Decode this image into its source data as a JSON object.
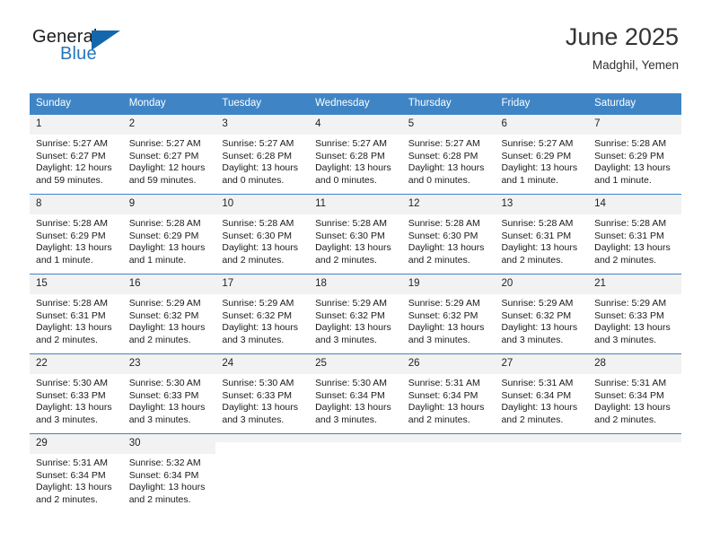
{
  "brand": {
    "name_part1": "General",
    "name_part2": "Blue",
    "triangle_color": "#1567ad",
    "blue_text_color": "#2476bd"
  },
  "header": {
    "title": "June 2025",
    "subtitle": "Madghil, Yemen",
    "header_bg": "#3f85c6",
    "daynum_bg": "#f2f2f2"
  },
  "weekdays": [
    "Sunday",
    "Monday",
    "Tuesday",
    "Wednesday",
    "Thursday",
    "Friday",
    "Saturday"
  ],
  "weeks": [
    [
      {
        "day": "1",
        "sunrise": "Sunrise: 5:27 AM",
        "sunset": "Sunset: 6:27 PM",
        "daylight_line1": "Daylight: 12 hours",
        "daylight_line2": "and 59 minutes."
      },
      {
        "day": "2",
        "sunrise": "Sunrise: 5:27 AM",
        "sunset": "Sunset: 6:27 PM",
        "daylight_line1": "Daylight: 12 hours",
        "daylight_line2": "and 59 minutes."
      },
      {
        "day": "3",
        "sunrise": "Sunrise: 5:27 AM",
        "sunset": "Sunset: 6:28 PM",
        "daylight_line1": "Daylight: 13 hours",
        "daylight_line2": "and 0 minutes."
      },
      {
        "day": "4",
        "sunrise": "Sunrise: 5:27 AM",
        "sunset": "Sunset: 6:28 PM",
        "daylight_line1": "Daylight: 13 hours",
        "daylight_line2": "and 0 minutes."
      },
      {
        "day": "5",
        "sunrise": "Sunrise: 5:27 AM",
        "sunset": "Sunset: 6:28 PM",
        "daylight_line1": "Daylight: 13 hours",
        "daylight_line2": "and 0 minutes."
      },
      {
        "day": "6",
        "sunrise": "Sunrise: 5:27 AM",
        "sunset": "Sunset: 6:29 PM",
        "daylight_line1": "Daylight: 13 hours",
        "daylight_line2": "and 1 minute."
      },
      {
        "day": "7",
        "sunrise": "Sunrise: 5:28 AM",
        "sunset": "Sunset: 6:29 PM",
        "daylight_line1": "Daylight: 13 hours",
        "daylight_line2": "and 1 minute."
      }
    ],
    [
      {
        "day": "8",
        "sunrise": "Sunrise: 5:28 AM",
        "sunset": "Sunset: 6:29 PM",
        "daylight_line1": "Daylight: 13 hours",
        "daylight_line2": "and 1 minute."
      },
      {
        "day": "9",
        "sunrise": "Sunrise: 5:28 AM",
        "sunset": "Sunset: 6:29 PM",
        "daylight_line1": "Daylight: 13 hours",
        "daylight_line2": "and 1 minute."
      },
      {
        "day": "10",
        "sunrise": "Sunrise: 5:28 AM",
        "sunset": "Sunset: 6:30 PM",
        "daylight_line1": "Daylight: 13 hours",
        "daylight_line2": "and 2 minutes."
      },
      {
        "day": "11",
        "sunrise": "Sunrise: 5:28 AM",
        "sunset": "Sunset: 6:30 PM",
        "daylight_line1": "Daylight: 13 hours",
        "daylight_line2": "and 2 minutes."
      },
      {
        "day": "12",
        "sunrise": "Sunrise: 5:28 AM",
        "sunset": "Sunset: 6:30 PM",
        "daylight_line1": "Daylight: 13 hours",
        "daylight_line2": "and 2 minutes."
      },
      {
        "day": "13",
        "sunrise": "Sunrise: 5:28 AM",
        "sunset": "Sunset: 6:31 PM",
        "daylight_line1": "Daylight: 13 hours",
        "daylight_line2": "and 2 minutes."
      },
      {
        "day": "14",
        "sunrise": "Sunrise: 5:28 AM",
        "sunset": "Sunset: 6:31 PM",
        "daylight_line1": "Daylight: 13 hours",
        "daylight_line2": "and 2 minutes."
      }
    ],
    [
      {
        "day": "15",
        "sunrise": "Sunrise: 5:28 AM",
        "sunset": "Sunset: 6:31 PM",
        "daylight_line1": "Daylight: 13 hours",
        "daylight_line2": "and 2 minutes."
      },
      {
        "day": "16",
        "sunrise": "Sunrise: 5:29 AM",
        "sunset": "Sunset: 6:32 PM",
        "daylight_line1": "Daylight: 13 hours",
        "daylight_line2": "and 2 minutes."
      },
      {
        "day": "17",
        "sunrise": "Sunrise: 5:29 AM",
        "sunset": "Sunset: 6:32 PM",
        "daylight_line1": "Daylight: 13 hours",
        "daylight_line2": "and 3 minutes."
      },
      {
        "day": "18",
        "sunrise": "Sunrise: 5:29 AM",
        "sunset": "Sunset: 6:32 PM",
        "daylight_line1": "Daylight: 13 hours",
        "daylight_line2": "and 3 minutes."
      },
      {
        "day": "19",
        "sunrise": "Sunrise: 5:29 AM",
        "sunset": "Sunset: 6:32 PM",
        "daylight_line1": "Daylight: 13 hours",
        "daylight_line2": "and 3 minutes."
      },
      {
        "day": "20",
        "sunrise": "Sunrise: 5:29 AM",
        "sunset": "Sunset: 6:32 PM",
        "daylight_line1": "Daylight: 13 hours",
        "daylight_line2": "and 3 minutes."
      },
      {
        "day": "21",
        "sunrise": "Sunrise: 5:29 AM",
        "sunset": "Sunset: 6:33 PM",
        "daylight_line1": "Daylight: 13 hours",
        "daylight_line2": "and 3 minutes."
      }
    ],
    [
      {
        "day": "22",
        "sunrise": "Sunrise: 5:30 AM",
        "sunset": "Sunset: 6:33 PM",
        "daylight_line1": "Daylight: 13 hours",
        "daylight_line2": "and 3 minutes."
      },
      {
        "day": "23",
        "sunrise": "Sunrise: 5:30 AM",
        "sunset": "Sunset: 6:33 PM",
        "daylight_line1": "Daylight: 13 hours",
        "daylight_line2": "and 3 minutes."
      },
      {
        "day": "24",
        "sunrise": "Sunrise: 5:30 AM",
        "sunset": "Sunset: 6:33 PM",
        "daylight_line1": "Daylight: 13 hours",
        "daylight_line2": "and 3 minutes."
      },
      {
        "day": "25",
        "sunrise": "Sunrise: 5:30 AM",
        "sunset": "Sunset: 6:34 PM",
        "daylight_line1": "Daylight: 13 hours",
        "daylight_line2": "and 3 minutes."
      },
      {
        "day": "26",
        "sunrise": "Sunrise: 5:31 AM",
        "sunset": "Sunset: 6:34 PM",
        "daylight_line1": "Daylight: 13 hours",
        "daylight_line2": "and 2 minutes."
      },
      {
        "day": "27",
        "sunrise": "Sunrise: 5:31 AM",
        "sunset": "Sunset: 6:34 PM",
        "daylight_line1": "Daylight: 13 hours",
        "daylight_line2": "and 2 minutes."
      },
      {
        "day": "28",
        "sunrise": "Sunrise: 5:31 AM",
        "sunset": "Sunset: 6:34 PM",
        "daylight_line1": "Daylight: 13 hours",
        "daylight_line2": "and 2 minutes."
      }
    ],
    [
      {
        "day": "29",
        "sunrise": "Sunrise: 5:31 AM",
        "sunset": "Sunset: 6:34 PM",
        "daylight_line1": "Daylight: 13 hours",
        "daylight_line2": "and 2 minutes."
      },
      {
        "day": "30",
        "sunrise": "Sunrise: 5:32 AM",
        "sunset": "Sunset: 6:34 PM",
        "daylight_line1": "Daylight: 13 hours",
        "daylight_line2": "and 2 minutes."
      },
      {
        "day": "",
        "sunrise": "",
        "sunset": "",
        "daylight_line1": "",
        "daylight_line2": ""
      },
      {
        "day": "",
        "sunrise": "",
        "sunset": "",
        "daylight_line1": "",
        "daylight_line2": ""
      },
      {
        "day": "",
        "sunrise": "",
        "sunset": "",
        "daylight_line1": "",
        "daylight_line2": ""
      },
      {
        "day": "",
        "sunrise": "",
        "sunset": "",
        "daylight_line1": "",
        "daylight_line2": ""
      },
      {
        "day": "",
        "sunrise": "",
        "sunset": "",
        "daylight_line1": "",
        "daylight_line2": ""
      }
    ]
  ]
}
